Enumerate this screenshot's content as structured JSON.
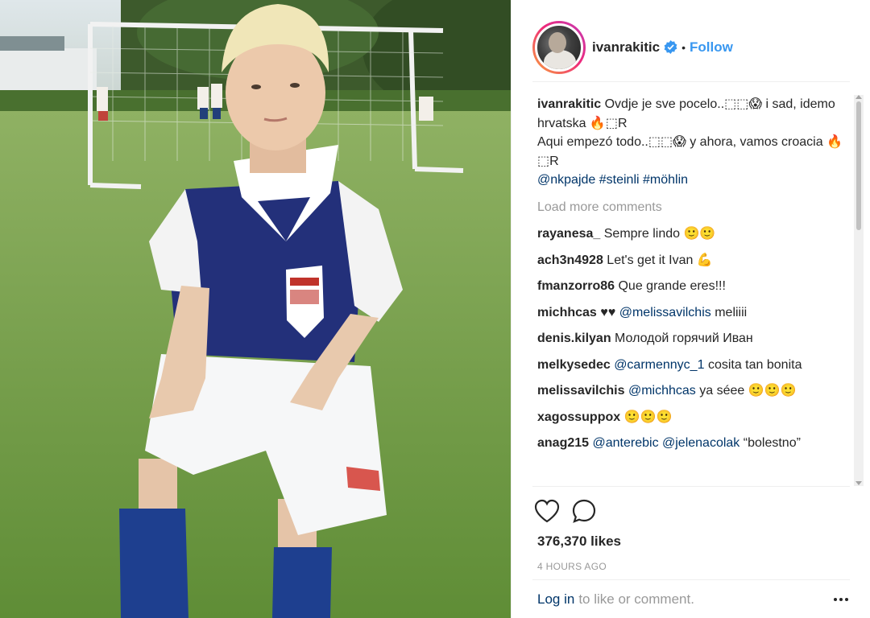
{
  "post": {
    "username": "ivanrakitic",
    "verified": true,
    "separator": "•",
    "follow_label": "Follow"
  },
  "caption": {
    "user": "ivanrakitic",
    "line1": "Ovdje je sve pocelo..⬚⬚😱 i sad, idemo hrvatska 🔥⬚R",
    "line2": "Aqui empezó todo..⬚⬚😱 y ahora, vamos croacia 🔥⬚R",
    "mentions": "@nkpajde",
    "tag1": "#steinli",
    "tag2": "#möhlin"
  },
  "load_more": "Load more comments",
  "comments": [
    {
      "user": "rayanesa_",
      "mention": "",
      "text": "Sempre lindo 🙂🙂"
    },
    {
      "user": "ach3n4928",
      "mention": "",
      "text": "Let's get it Ivan 💪"
    },
    {
      "user": "fmanzorro86",
      "mention": "",
      "text": "Que grande eres!!!"
    },
    {
      "user": "michhcas",
      "mention": "@melissavilchis",
      "pre": "♥♥",
      "text": "meliiii"
    },
    {
      "user": "denis.kilyan",
      "mention": "",
      "text": "Молодой горячий Иван"
    },
    {
      "user": "melkysedec",
      "mention": "@carmennyc_1",
      "text": "cosita tan bonita"
    },
    {
      "user": "melissavilchis",
      "mention": "@michhcas",
      "text": "ya séee 🙂🙂🙂"
    },
    {
      "user": "xagossuppox",
      "mention": "",
      "text": "🙂🙂🙂"
    },
    {
      "user": "anag215",
      "mention": "@anterebic @jelenacolak",
      "text": "“bolestno”"
    }
  ],
  "actions": {
    "like_icon": "heart-icon",
    "comment_icon": "comment-icon",
    "likes": "376,370 likes",
    "time": "4 HOURS AGO"
  },
  "footer": {
    "login": "Log in",
    "rest": "to like or comment.",
    "more_icon": "more-options-icon"
  },
  "colors": {
    "link": "#3897f0",
    "mention": "#003569",
    "muted": "#999999",
    "text": "#262626"
  }
}
